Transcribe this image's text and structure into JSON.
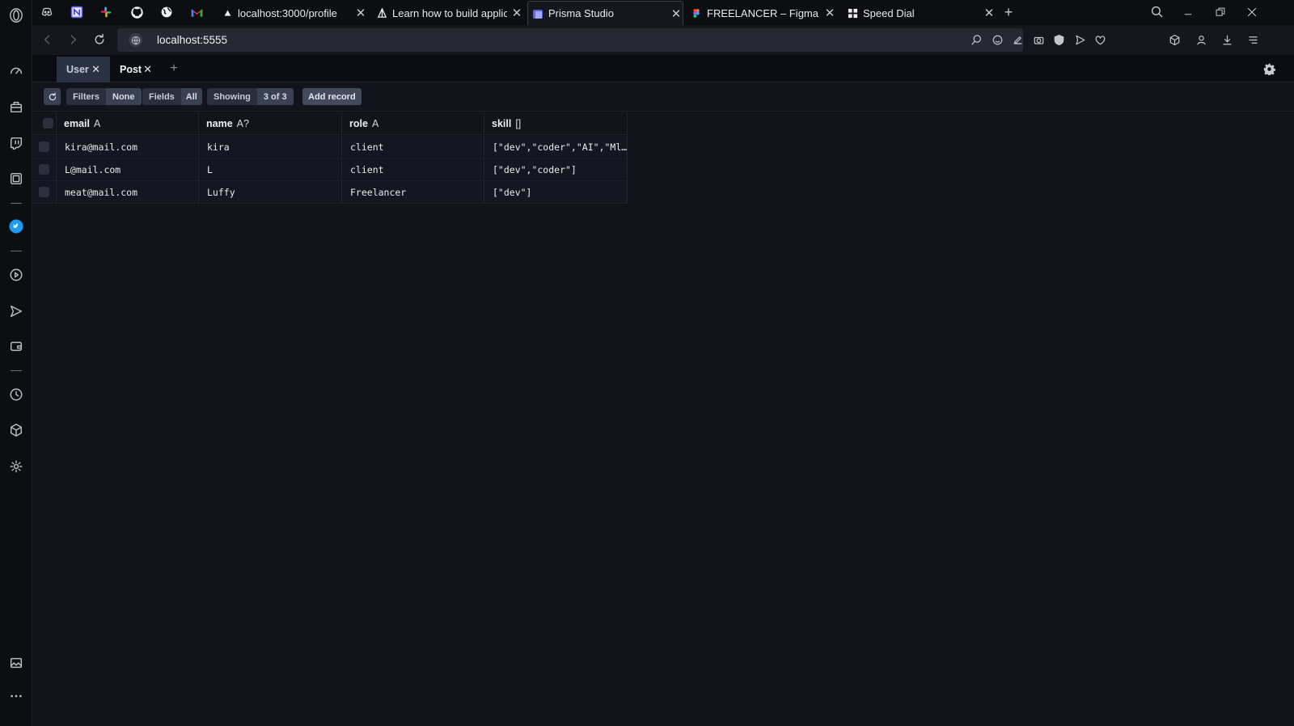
{
  "browser": {
    "pinned": [
      "discord-icon",
      "notion-icon",
      "slack-icon",
      "github-icon",
      "globe-icon",
      "gmail-icon"
    ],
    "tabs": [
      {
        "label": "localhost:3000/profile",
        "icon": "vercel-icon"
      },
      {
        "label": "Learn how to build applicat",
        "icon": "ship-icon"
      },
      {
        "label": "Prisma Studio",
        "icon": "prisma-icon",
        "active": true
      },
      {
        "label": "FREELANCER – Figma",
        "icon": "figma-icon"
      },
      {
        "label": "Speed Dial",
        "icon": "grid-icon"
      }
    ],
    "url": "localhost:5555"
  },
  "studio": {
    "model_tabs": [
      {
        "label": "User"
      },
      {
        "label": "Post"
      }
    ],
    "toolbar": {
      "filters_label": "Filters",
      "filters_value": "None",
      "fields_label": "Fields",
      "fields_value": "All",
      "showing_label": "Showing",
      "showing_value": "3 of 3",
      "add_record_label": "Add record"
    },
    "columns": [
      {
        "name": "email",
        "type": "A"
      },
      {
        "name": "name",
        "type": "A?"
      },
      {
        "name": "role",
        "type": "A"
      },
      {
        "name": "skill",
        "type": "[]"
      }
    ],
    "rows": [
      {
        "email": "kira@mail.com",
        "name": "kira",
        "role": "client",
        "skill": "[\"dev\",\"coder\",\"AI\",\"Ml…"
      },
      {
        "email": "L@mail.com",
        "name": "L",
        "role": "client",
        "skill": "[\"dev\",\"coder\"]"
      },
      {
        "email": "meat@mail.com",
        "name": "Luffy",
        "role": "Freelancer",
        "skill": "[\"dev\"]"
      }
    ]
  }
}
